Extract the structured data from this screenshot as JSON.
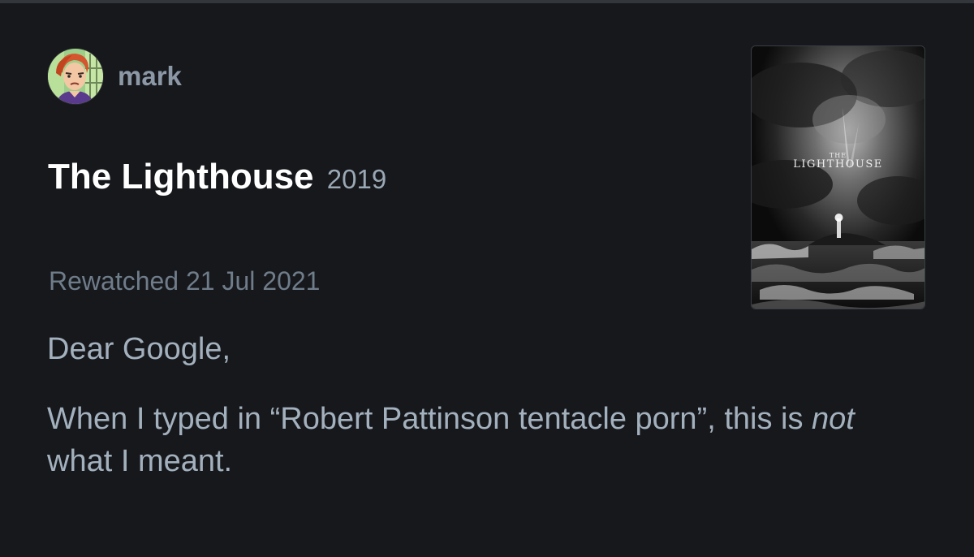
{
  "user": {
    "name": "mark"
  },
  "film": {
    "title": "The Lighthouse",
    "year": "2019",
    "poster": {
      "title_small": "THE",
      "title_big": "LIGHTHOUSE"
    }
  },
  "entry": {
    "status": "Rewatched 21 Jul 2021"
  },
  "review": {
    "greeting": "Dear Google,",
    "line_before_emphasis": "When I typed in “Robert Pattinson tentacle porn”, this is ",
    "emphasis": "not",
    "line_after_emphasis": " what I meant."
  }
}
